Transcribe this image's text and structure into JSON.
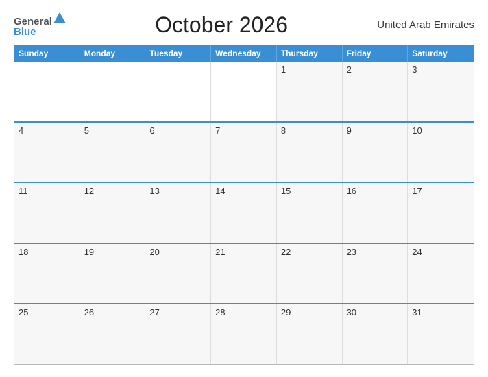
{
  "header": {
    "logo_general": "General",
    "logo_blue": "Blue",
    "title": "October 2026",
    "country": "United Arab Emirates"
  },
  "calendar": {
    "days_of_week": [
      "Sunday",
      "Monday",
      "Tuesday",
      "Wednesday",
      "Thursday",
      "Friday",
      "Saturday"
    ],
    "weeks": [
      [
        "",
        "",
        "",
        "",
        "1",
        "2",
        "3"
      ],
      [
        "4",
        "5",
        "6",
        "7",
        "8",
        "9",
        "10"
      ],
      [
        "11",
        "12",
        "13",
        "14",
        "15",
        "16",
        "17"
      ],
      [
        "18",
        "19",
        "20",
        "21",
        "22",
        "23",
        "24"
      ],
      [
        "25",
        "26",
        "27",
        "28",
        "29",
        "30",
        "31"
      ]
    ]
  }
}
